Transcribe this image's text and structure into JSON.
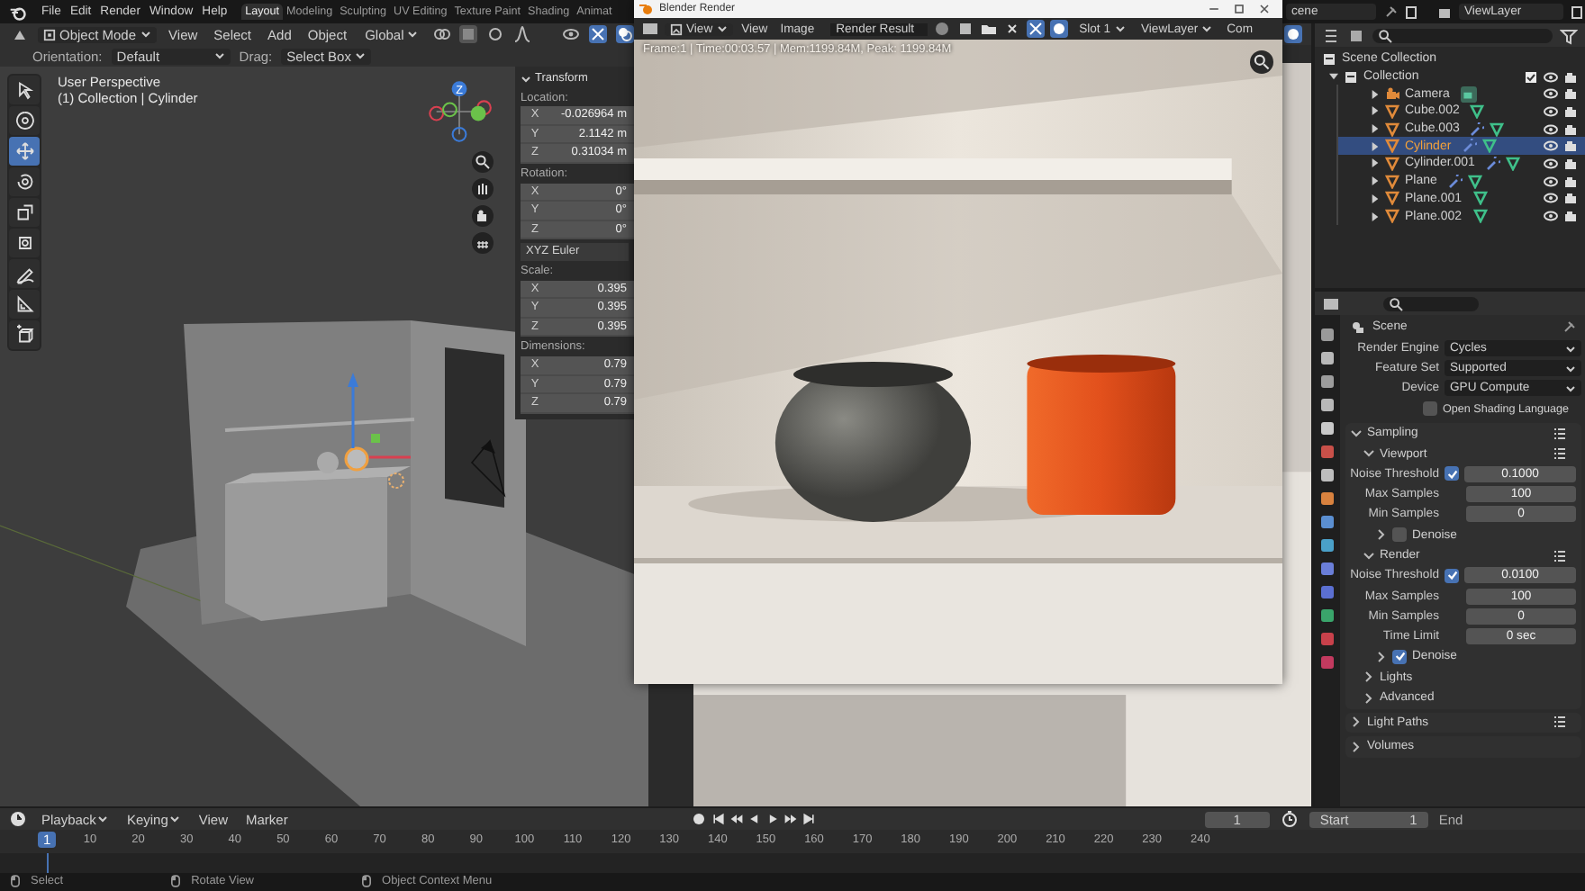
{
  "top_bar": {
    "menus": [
      "File",
      "Edit",
      "Render",
      "Window",
      "Help"
    ],
    "workspaces": [
      {
        "label": "Layout",
        "selected": true
      },
      {
        "label": "Modeling",
        "selected": false
      },
      {
        "label": "Sculpting",
        "selected": false
      },
      {
        "label": "UV Editing",
        "selected": false
      },
      {
        "label": "Texture Paint",
        "selected": false
      },
      {
        "label": "Shading",
        "selected": false
      },
      {
        "label": "Animat",
        "selected": false
      }
    ],
    "scene": "cene",
    "view_layer": "ViewLayer"
  },
  "viewport": {
    "header": {
      "mode": "Object Mode",
      "menus": [
        "View",
        "Select",
        "Add",
        "Object"
      ],
      "orientation": "Global"
    },
    "tool_settings": {
      "orientation_label": "Orientation:",
      "orientation": "Default",
      "drag_label": "Drag:",
      "drag": "Select Box"
    },
    "tools": [
      {
        "selected": false
      },
      {
        "selected": false
      },
      {
        "selected": true
      },
      {
        "selected": false
      },
      {
        "selected": false
      },
      {
        "selected": false
      },
      {
        "selected": false
      },
      {
        "selected": false
      },
      {
        "selected": false
      }
    ],
    "info": [
      "User Perspective",
      "(1) Collection | Cylinder"
    ],
    "gizmo_label": "Z",
    "transform": {
      "title": "Transform",
      "location": {
        "label": "Location:",
        "fields": [
          {
            "axis": "X",
            "value": "-0.026964 m"
          },
          {
            "axis": "Y",
            "value": "2.1142 m"
          },
          {
            "axis": "Z",
            "value": "0.31034 m"
          }
        ]
      },
      "rotation": {
        "label": "Rotation:",
        "fields": [
          {
            "axis": "X",
            "value": "0°"
          },
          {
            "axis": "Y",
            "value": "0°"
          },
          {
            "axis": "Z",
            "value": "0°"
          }
        ]
      },
      "rotation_mode": "XYZ Euler",
      "scale": {
        "label": "Scale:",
        "fields": [
          {
            "axis": "X",
            "value": "0.395"
          },
          {
            "axis": "Y",
            "value": "0.395"
          },
          {
            "axis": "Z",
            "value": "0.395"
          }
        ]
      },
      "dimensions": {
        "label": "Dimensions:",
        "fields": [
          {
            "axis": "X",
            "value": "0.79"
          },
          {
            "axis": "Y",
            "value": "0.79"
          },
          {
            "axis": "Z",
            "value": "0.79"
          }
        ]
      }
    }
  },
  "render_window": {
    "title": "Blender Render",
    "view_mode": "View",
    "menus": [
      "View",
      "Image"
    ],
    "image": "Render Result",
    "slot": "Slot 1",
    "view_layer": "ViewLayer",
    "pass": "Com",
    "info": "Frame:1 | Time:00:03.57 | Mem:1199.84M, Peak: 1199.84M"
  },
  "outliner": {
    "tree": {
      "name": "Scene Collection",
      "children": [
        {
          "name": "Collection",
          "expanded": true,
          "children": [
            {
              "name": "Camera",
              "kind": "camera",
              "selected": false,
              "modifier": false,
              "expanded": false
            },
            {
              "name": "Cube.002",
              "kind": "mesh",
              "selected": false,
              "modifier": false,
              "expanded": false
            },
            {
              "name": "Cube.003",
              "kind": "mesh",
              "selected": false,
              "modifier": true,
              "expanded": false
            },
            {
              "name": "Cylinder",
              "kind": "mesh",
              "selected": true,
              "modifier": true,
              "expanded": false
            },
            {
              "name": "Cylinder.001",
              "kind": "mesh",
              "selected": false,
              "modifier": true,
              "expanded": false
            },
            {
              "name": "Plane",
              "kind": "mesh",
              "selected": false,
              "modifier": true,
              "expanded": false
            },
            {
              "name": "Plane.001",
              "kind": "mesh",
              "selected": false,
              "modifier": false,
              "expanded": false
            },
            {
              "name": "Plane.002",
              "kind": "mesh",
              "selected": false,
              "modifier": false,
              "expanded": false
            }
          ]
        }
      ]
    }
  },
  "properties": {
    "context": "Scene",
    "fields": [
      {
        "kind": "dropdown",
        "label": "Render Engine",
        "value": "Cycles"
      },
      {
        "kind": "dropdown",
        "label": "Feature Set",
        "value": "Supported"
      },
      {
        "kind": "dropdown",
        "label": "Device",
        "value": "GPU Compute"
      },
      {
        "kind": "checkbox",
        "label": "Open Shading Language",
        "checked": false
      }
    ],
    "panels": [
      {
        "title": "Sampling",
        "expanded": true,
        "presets": true,
        "children": [
          {
            "title": "Viewport",
            "expanded": true,
            "presets": true,
            "rows": [
              {
                "kind": "check-number",
                "label": "Noise Threshold",
                "checked": true,
                "value": "0.1000"
              },
              {
                "kind": "number",
                "label": "Max Samples",
                "value": "100"
              },
              {
                "kind": "number",
                "label": "Min Samples",
                "value": "0"
              }
            ],
            "children": [
              {
                "title": "Denoise",
                "expanded": false,
                "checkbox": false
              }
            ]
          },
          {
            "title": "Render",
            "expanded": true,
            "presets": true,
            "rows": [
              {
                "kind": "check-number",
                "label": "Noise Threshold",
                "checked": true,
                "value": "0.0100"
              },
              {
                "kind": "number",
                "label": "Max Samples",
                "value": "100"
              },
              {
                "kind": "number",
                "label": "Min Samples",
                "value": "0"
              },
              {
                "kind": "number",
                "label": "Time Limit",
                "value": "0 sec"
              }
            ],
            "children": [
              {
                "title": "Denoise",
                "expanded": false,
                "checkbox": true
              }
            ]
          },
          {
            "title": "Lights",
            "expanded": false
          },
          {
            "title": "Advanced",
            "expanded": false
          }
        ]
      },
      {
        "title": "Light Paths",
        "expanded": false,
        "presets": true
      },
      {
        "title": "Volumes",
        "expanded": false
      }
    ]
  },
  "timeline": {
    "menus": [
      {
        "label": "Playback",
        "kind": "dropdown"
      },
      {
        "label": "Keying",
        "kind": "dropdown"
      },
      {
        "label": "View",
        "kind": "menu"
      },
      {
        "label": "Marker",
        "kind": "menu"
      }
    ],
    "current_frame": "1",
    "start_label": "Start",
    "start": "1",
    "end_label": "End",
    "ruler": {
      "playhead": "1",
      "labels": [
        "10",
        "20",
        "30",
        "40",
        "50",
        "60",
        "70",
        "80",
        "90",
        "100",
        "110",
        "120",
        "130",
        "140",
        "150",
        "160",
        "170",
        "180",
        "190",
        "200",
        "210",
        "220",
        "230",
        "240"
      ]
    }
  },
  "status_bar": [
    "Select",
    "Rotate View",
    "Object Context Menu"
  ]
}
